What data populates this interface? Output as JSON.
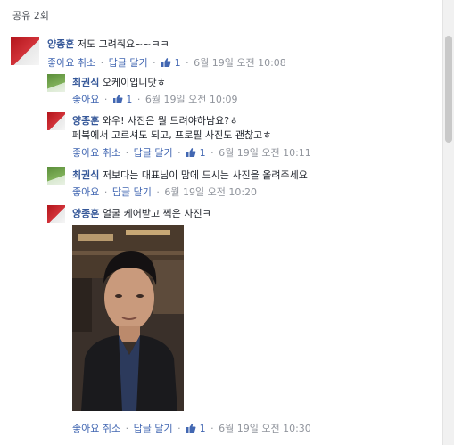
{
  "header": {
    "share_count": "공유 2회"
  },
  "meta_labels": {
    "like": "좋아요",
    "cancel": "취소",
    "reply": "답글 달기"
  },
  "comments": [
    {
      "author": "양종훈",
      "text": "저도 그려줘요~~ㅋㅋ",
      "likes": "1",
      "time": "6월 19일 오전 10:08"
    },
    {
      "author": "최권식",
      "text": "오케이입니닷ㅎ",
      "likes": "1",
      "time": "6월 19일 오전 10:09"
    },
    {
      "author": "양종훈",
      "text": "와우! 사진은 뭘 드려야하남요?ㅎ",
      "text2": "페북에서 고르셔도 되고, 프로필 사진도 괜찮고ㅎ",
      "likes": "1",
      "time": "6월 19일 오전 10:11"
    },
    {
      "author": "최권식",
      "text": "저보다는 대표님이 맘에 드시는 사진을 올려주세요",
      "time": "6월 19일 오전 10:20"
    },
    {
      "author": "양종훈",
      "text": "얼굴 케어받고 찍은 사진ㅋ",
      "likes": "1",
      "time": "6월 19일 오전 10:30"
    }
  ]
}
